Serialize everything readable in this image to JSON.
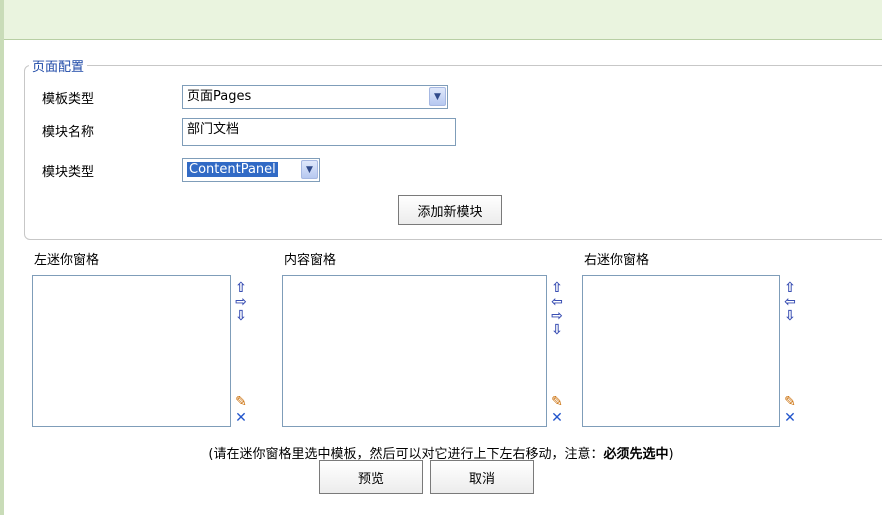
{
  "fieldset": {
    "legend": "页面配置"
  },
  "form": {
    "template_type": {
      "label": "模板类型",
      "value": "页面Pages"
    },
    "module_name": {
      "label": "模块名称",
      "value": "部门文档"
    },
    "module_type": {
      "label": "模块类型",
      "value": "ContentPanel"
    },
    "add_button": "添加新模块"
  },
  "panes": {
    "left": {
      "label": "左迷你窗格"
    },
    "content": {
      "label": "内容窗格"
    },
    "right": {
      "label": "右迷你窗格"
    }
  },
  "note": {
    "text": "(请在迷你窗格里选中模板，然后可以对它进行上下左右移动，注意：",
    "bold": "必须先选中",
    "close": ")"
  },
  "buttons": {
    "preview": "预览",
    "cancel": "取消"
  },
  "colors": {
    "accent": "#1f4aa8",
    "topbar": "#eaf4df",
    "border": "#7f9db9",
    "selected": "#316ac5"
  }
}
